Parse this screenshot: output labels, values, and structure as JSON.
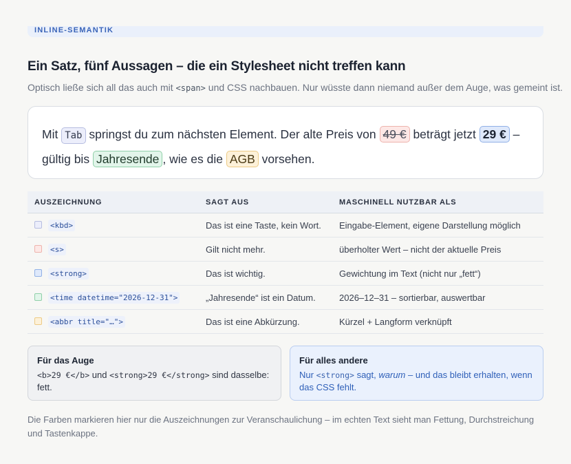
{
  "eyebrow": "INLINE-SEMANTIK",
  "title": "Ein Satz, fünf Aussagen – die ein Stylesheet nicht treffen kann",
  "subtitle": {
    "before": "Optisch ließe sich all das auch mit ",
    "code": "<span>",
    "after": " und CSS nachbauen. Nur wüsste dann niemand außer dem Auge, was gemeint ist."
  },
  "sentence": {
    "p1": "Mit ",
    "kbd": "Tab",
    "p2": " springst du zum nächsten Element. Der alte Preis von ",
    "s": "49 €",
    "p3": " beträgt jetzt ",
    "strong": "29 €",
    "p4": " – gültig bis ",
    "time": "Jahresende",
    "p5": ", wie es die ",
    "abbr": "AGB",
    "p6": " vorsehen."
  },
  "table": {
    "headers": [
      "AUSZEICHNUNG",
      "SAGT AUS",
      "MASCHINELL NUTZBAR ALS"
    ],
    "rows": [
      {
        "code": "<kbd>",
        "says": "Das ist eine Taste, kein Wort.",
        "usable": "Eingabe-Element, eigene Darstellung möglich"
      },
      {
        "code": "<s>",
        "says": "Gilt nicht mehr.",
        "usable": "überholter Wert – nicht der aktuelle Preis"
      },
      {
        "code": "<strong>",
        "says": "Das ist wichtig.",
        "usable": "Gewichtung im Text (nicht nur „fett“)"
      },
      {
        "code": "<time datetime=\"2026-12-31\">",
        "says": "„Jahresende“ ist ein Datum.",
        "usable": "2026–12–31 – sortierbar, auswertbar"
      },
      {
        "code": "<abbr title=\"…\">",
        "says": "Das ist eine Abkürzung.",
        "usable": "Kürzel + Langform verknüpft"
      }
    ]
  },
  "colors": {
    "kbd": "#b6bde0",
    "s": "#eeb3ad",
    "strong": "#90b0e6",
    "time": "#8fd0a8",
    "abbr": "#edca84"
  },
  "panel_left": {
    "title": "Für das Auge",
    "code1": "<b>29 €</b>",
    "mid": " und ",
    "code2": "<strong>29 €</strong>",
    "after": " sind dasselbe: fett."
  },
  "panel_right": {
    "title": "Für alles andere",
    "before": "Nur ",
    "code": "<strong>",
    "mid": " sagt, ",
    "em": "warum",
    "after": " – und das bleibt erhalten, wenn das CSS fehlt."
  },
  "footnote": "Die Farben markieren hier nur die Auszeichnungen zur Veranschaulichung – im echten Text sieht man Fettung, Durchstreichung und Tastenkappe."
}
